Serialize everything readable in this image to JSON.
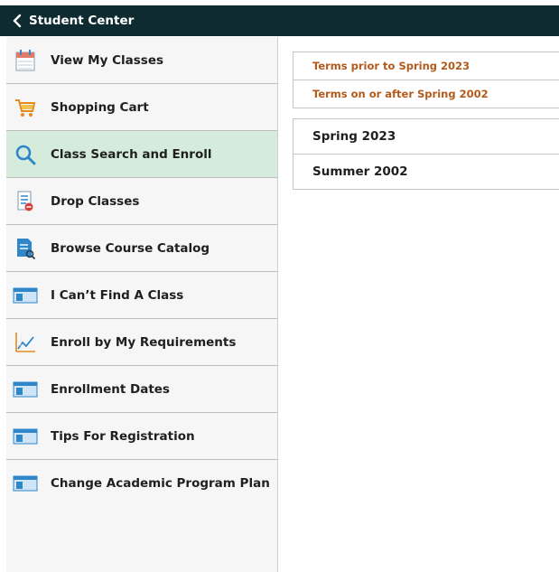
{
  "header": {
    "title": "Student Center",
    "back_icon": "chevron-left-icon"
  },
  "sidebar": {
    "active_color": "#d5ecdd",
    "items": [
      {
        "label": "View My Classes",
        "icon": "calendar-icon"
      },
      {
        "label": "Shopping Cart",
        "icon": "cart-icon"
      },
      {
        "label": "Class Search and Enroll",
        "icon": "search-icon",
        "active": true
      },
      {
        "label": "Drop Classes",
        "icon": "drop-list-icon"
      },
      {
        "label": "Browse Course Catalog",
        "icon": "catalog-icon"
      },
      {
        "label": "I Can’t Find A Class",
        "icon": "window-icon"
      },
      {
        "label": "Enroll by My Requirements",
        "icon": "chart-icon"
      },
      {
        "label": "Enrollment Dates",
        "icon": "window-icon"
      },
      {
        "label": "Tips For Registration",
        "icon": "window-icon"
      },
      {
        "label": "Change Academic Program Plan",
        "icon": "window-icon"
      }
    ]
  },
  "terms": {
    "links": [
      "Terms prior to Spring 2023",
      "Terms on or after Spring 2002"
    ],
    "rows": [
      "Spring 2023",
      "Summer 2002"
    ],
    "link_color": "#b35a1b"
  }
}
